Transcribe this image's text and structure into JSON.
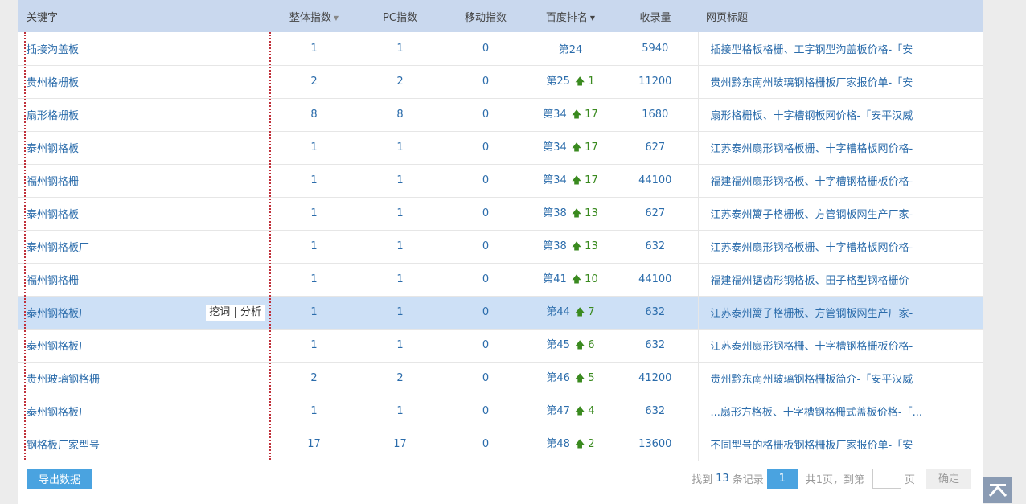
{
  "header": {
    "keyword": "关键字",
    "overall": "整体指数",
    "pc": "PC指数",
    "mobile": "移动指数",
    "rank": "百度排名",
    "indexed": "收录量",
    "title": "网页标题"
  },
  "popup": {
    "mine": "挖词",
    "sep": "|",
    "analyze": "分析"
  },
  "rows": [
    {
      "keyword": "插接沟盖板",
      "overall": "1",
      "pc": "1",
      "mobile": "0",
      "rank": "第24",
      "change": "",
      "indexed": "5940",
      "title": "插接型格板格栅、工字钢型沟盖板价格-「安"
    },
    {
      "keyword": "贵州格栅板",
      "overall": "2",
      "pc": "2",
      "mobile": "0",
      "rank": "第25",
      "change": "1",
      "indexed": "11200",
      "title": "贵州黔东南州玻璃钢格栅板厂家报价单-「安"
    },
    {
      "keyword": "扇形格栅板",
      "overall": "8",
      "pc": "8",
      "mobile": "0",
      "rank": "第34",
      "change": "17",
      "indexed": "1680",
      "title": "扇形格栅板、十字槽钢板网价格-「安平汉威"
    },
    {
      "keyword": "泰州钢格板",
      "overall": "1",
      "pc": "1",
      "mobile": "0",
      "rank": "第34",
      "change": "17",
      "indexed": "627",
      "title": "江苏泰州扇形钢格板栅、十字槽格板网价格-"
    },
    {
      "keyword": "福州钢格栅",
      "overall": "1",
      "pc": "1",
      "mobile": "0",
      "rank": "第34",
      "change": "17",
      "indexed": "44100",
      "title": "福建福州扇形钢格板、十字槽钢格栅板价格-"
    },
    {
      "keyword": "泰州钢格板",
      "overall": "1",
      "pc": "1",
      "mobile": "0",
      "rank": "第38",
      "change": "13",
      "indexed": "627",
      "title": "江苏泰州篱子格栅板、方管钢板网生产厂家-"
    },
    {
      "keyword": "泰州钢格板厂",
      "overall": "1",
      "pc": "1",
      "mobile": "0",
      "rank": "第38",
      "change": "13",
      "indexed": "632",
      "title": "江苏泰州扇形钢格板栅、十字槽格板网价格-"
    },
    {
      "keyword": "福州钢格栅",
      "overall": "1",
      "pc": "1",
      "mobile": "0",
      "rank": "第41",
      "change": "10",
      "indexed": "44100",
      "title": "福建福州锯齿形钢格板、田子格型钢格栅价"
    },
    {
      "keyword": "泰州钢格板厂",
      "overall": "1",
      "pc": "1",
      "mobile": "0",
      "rank": "第44",
      "change": "7",
      "indexed": "632",
      "title": "江苏泰州篱子格栅板、方管钢板网生产厂家-"
    },
    {
      "keyword": "泰州钢格板厂",
      "overall": "1",
      "pc": "1",
      "mobile": "0",
      "rank": "第45",
      "change": "6",
      "indexed": "632",
      "title": "江苏泰州扇形钢格栅、十字槽钢格栅板价格-"
    },
    {
      "keyword": "贵州玻璃钢格栅",
      "overall": "2",
      "pc": "2",
      "mobile": "0",
      "rank": "第46",
      "change": "5",
      "indexed": "41200",
      "title": "贵州黔东南州玻璃钢格栅板简介-「安平汉威"
    },
    {
      "keyword": "泰州钢格板厂",
      "overall": "1",
      "pc": "1",
      "mobile": "0",
      "rank": "第47",
      "change": "4",
      "indexed": "632",
      "title": "...扇形方格板、十字槽钢格栅式盖板价格-「..."
    },
    {
      "keyword": "钢格板厂家型号",
      "overall": "17",
      "pc": "17",
      "mobile": "0",
      "rank": "第48",
      "change": "2",
      "indexed": "13600",
      "title": "不同型号的格栅板钢格栅板厂家报价单-「安"
    }
  ],
  "footer": {
    "export": "导出数据",
    "found_prefix": "找到",
    "found_count": "13",
    "found_suffix": "条记录",
    "current_page": "1",
    "total_pages": "共1页，到第",
    "page_unit": "页",
    "confirm": "确定"
  },
  "colors": {
    "header_bg": "#c9d8ee",
    "highlight_row": "#cde0f6",
    "link": "#2b6cab",
    "up_arrow": "#3a8a1f",
    "button": "#4aa3e0"
  },
  "icons": {
    "rank_up": "arrow-up-icon",
    "back_to_top": "chevron-up-icon",
    "sort": "sort-down-icon"
  }
}
